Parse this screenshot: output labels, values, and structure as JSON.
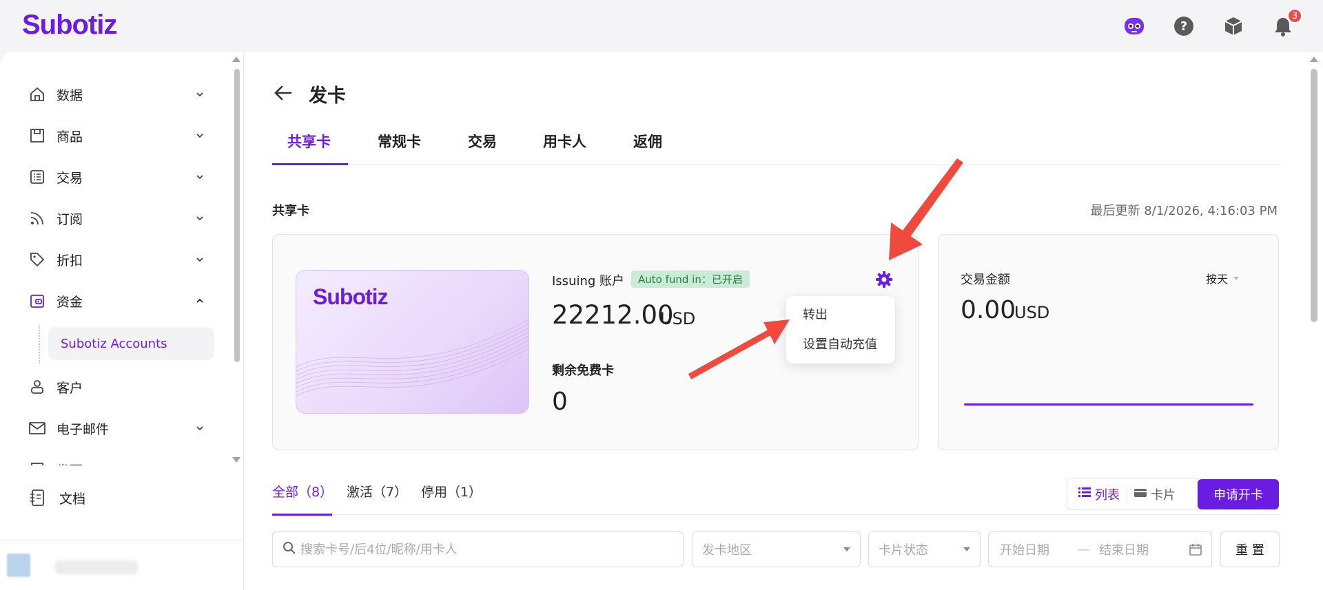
{
  "app": {
    "logo": "Subotiz"
  },
  "top_icons": {
    "notifications_count": "3"
  },
  "sidebar": {
    "items": [
      {
        "label": "数据",
        "icon": "home-icon"
      },
      {
        "label": "商品",
        "icon": "store-icon"
      },
      {
        "label": "交易",
        "icon": "list-icon"
      },
      {
        "label": "订阅",
        "icon": "rss-icon"
      },
      {
        "label": "折扣",
        "icon": "tag-icon"
      },
      {
        "label": "资金",
        "icon": "wallet-icon"
      },
      {
        "label": "客户",
        "icon": "person-icon"
      },
      {
        "label": "电子邮件",
        "icon": "mail-icon"
      },
      {
        "label": "发票",
        "icon": "invoice-icon"
      }
    ],
    "sub_item": "Subotiz Accounts",
    "docs": "文档"
  },
  "header": {
    "title": "发卡"
  },
  "tabs": [
    "共享卡",
    "常规卡",
    "交易",
    "用卡人",
    "返佣"
  ],
  "section": {
    "title": "共享卡",
    "last_updated": "最后更新 8/1/2026, 4:16:03 PM"
  },
  "account": {
    "card_logo": "Subotiz",
    "label": "Issuing 账户",
    "auto_fund": "Auto fund in：已开启",
    "balance": "22212.00",
    "currency": "USD",
    "free_cards_label": "剩余免费卡",
    "free_cards_value": "0"
  },
  "menu": {
    "items": [
      "转出",
      "设置自动充值"
    ]
  },
  "transactions": {
    "label": "交易金额",
    "period": "按天",
    "value": "0.00",
    "currency": "USD"
  },
  "filter_tabs": [
    "全部（8）",
    "激活（7）",
    "停用（1）"
  ],
  "view": {
    "list": "列表",
    "card": "卡片"
  },
  "apply_button": "申请开卡",
  "filters": {
    "search_placeholder": "搜索卡号/后4位/昵称/用卡人",
    "region": "发卡地区",
    "status": "卡片状态",
    "start_date": "开始日期",
    "end_date": "结束日期",
    "reset": "重 置"
  },
  "colors": {
    "accent": "#6a1de0",
    "badge_bg": "#c9ecd6",
    "badge_text": "#2f7a4a",
    "arrow": "#f04a3f"
  }
}
